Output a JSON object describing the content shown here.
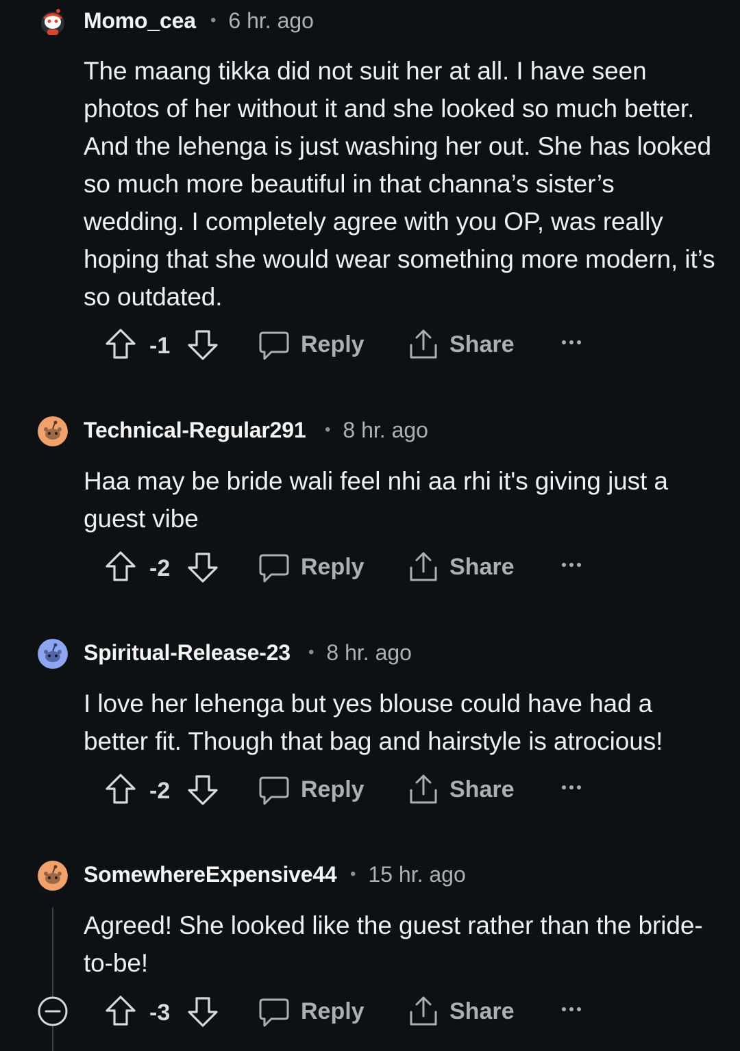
{
  "comments": [
    {
      "username": "Momo_cea",
      "time": "6 hr. ago",
      "avatar": "mascot-avatar-icon",
      "body": "The maang tikka did not suit her at all. I have seen photos of her without it and she looked so much better. And the lehenga is just washing her out. She has looked so much more beautiful in that channa’s sister’s wedding. I completely agree with you OP, was really hoping that she would wear something more modern, it’s so outdated.",
      "votes": "-1"
    },
    {
      "username": "Technical-Regular291",
      "time": "8 hr. ago",
      "avatar": "orange-snoo-avatar-icon",
      "body": "Haa may be bride wali feel nhi aa rhi it's giving just a guest vibe",
      "votes": "-2"
    },
    {
      "username": "Spiritual-Release-23",
      "time": "8 hr. ago",
      "avatar": "blue-snoo-avatar-icon",
      "body": "I love her lehenga but yes blouse could have had a better fit. Though that bag and hairstyle is atrocious!",
      "votes": "-2"
    },
    {
      "username": "SomewhereExpensive44",
      "time": "15 hr. ago",
      "avatar": "orange-snoo-avatar-icon",
      "body": "Agreed! She looked like the guest rather than the bride-to-be!",
      "votes": "-3"
    }
  ],
  "labels": {
    "reply": "Reply",
    "share": "Share",
    "dot": "•"
  },
  "colors": {
    "background": "#0e1113",
    "text": "#eef1f3",
    "muted": "#aab2b8",
    "orange_avatar": "#f0a26a",
    "blue_avatar": "#8ea6f0"
  }
}
